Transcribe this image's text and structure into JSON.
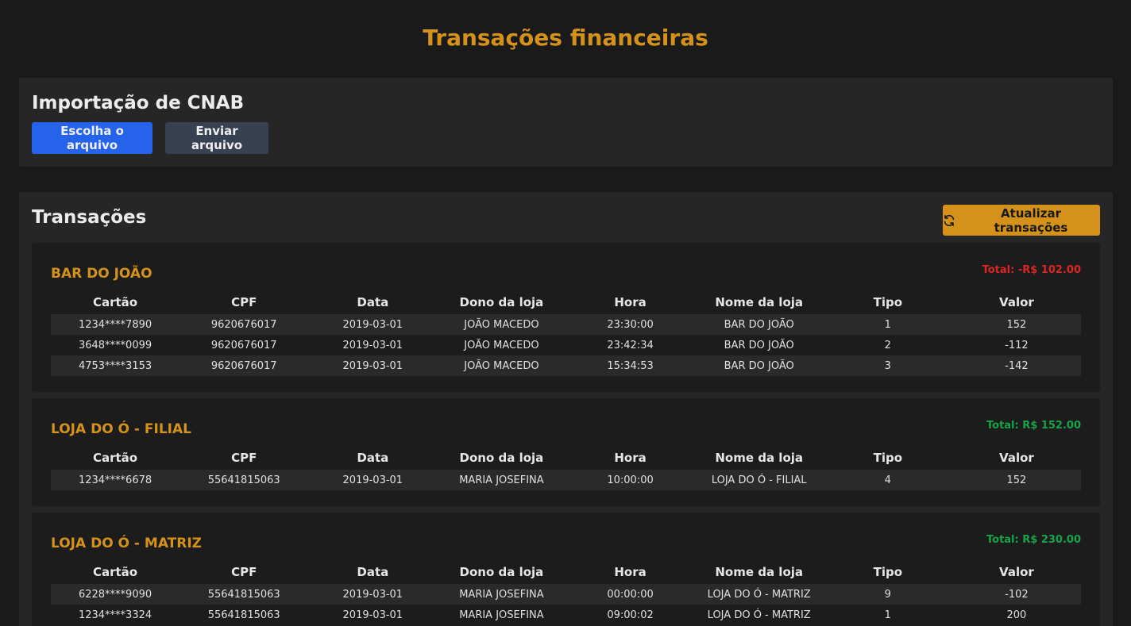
{
  "header": {
    "title": "Transações financeiras"
  },
  "import": {
    "title": "Importação de CNAB",
    "choose_label": "Escolha o arquivo",
    "send_label": "Enviar arquivo"
  },
  "transactions": {
    "title": "Transações",
    "refresh_label": "Atualizar transações",
    "columns": [
      "Cartão",
      "CPF",
      "Data",
      "Dono da loja",
      "Hora",
      "Nome da loja",
      "Tipo",
      "Valor"
    ],
    "stores": [
      {
        "name": "BAR DO JOÃO",
        "total": "Total: -R$ 102.00",
        "total_color": "#dc2626",
        "rows": [
          [
            "1234****7890",
            "9620676017",
            "2019-03-01",
            "JOÃO MACEDO",
            "23:30:00",
            "BAR DO JOÃO",
            "1",
            "152"
          ],
          [
            "3648****0099",
            "9620676017",
            "2019-03-01",
            "JOÃO MACEDO",
            "23:42:34",
            "BAR DO JOÃO",
            "2",
            "-112"
          ],
          [
            "4753****3153",
            "9620676017",
            "2019-03-01",
            "JOÃO MACEDO",
            "15:34:53",
            "BAR DO JOÃO",
            "3",
            "-142"
          ]
        ]
      },
      {
        "name": "LOJA DO Ó - FILIAL",
        "total": "Total: R$ 152.00",
        "total_color": "#16a34a",
        "rows": [
          [
            "1234****6678",
            "55641815063",
            "2019-03-01",
            "MARIA JOSEFINA",
            "10:00:00",
            "LOJA DO Ó - FILIAL",
            "4",
            "152"
          ]
        ]
      },
      {
        "name": "LOJA DO Ó - MATRIZ",
        "total": "Total: R$ 230.00",
        "total_color": "#16a34a",
        "rows": [
          [
            "6228****9090",
            "55641815063",
            "2019-03-01",
            "MARIA JOSEFINA",
            "00:00:00",
            "LOJA DO Ó - MATRIZ",
            "9",
            "-102"
          ],
          [
            "1234****3324",
            "55641815063",
            "2019-03-01",
            "MARIA JOSEFINA",
            "09:00:02",
            "LOJA DO Ó - MATRIZ",
            "1",
            "200"
          ]
        ]
      }
    ]
  },
  "colors": {
    "accent": "#d4921a",
    "primary_button": "#2563eb",
    "secondary_button": "#374151",
    "negative": "#dc2626",
    "positive": "#16a34a"
  },
  "icons": {
    "refresh": "refresh-icon"
  }
}
